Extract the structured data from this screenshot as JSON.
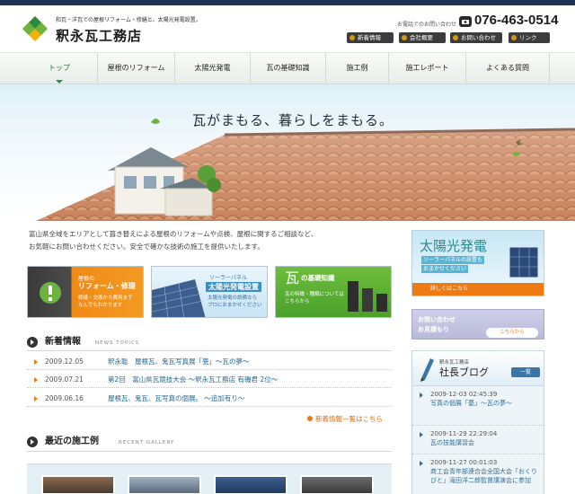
{
  "header": {
    "tagline": "和瓦・洋瓦での屋根リフォーム・修繕と、太陽光発電設置。",
    "company_name": "釈永瓦工務店",
    "phone_label": "お電話でのお問い合わせ",
    "phone_number": "076-463-0514",
    "utility_links": [
      "新着情報",
      "会社概要",
      "お問い合わせ",
      "リンク"
    ]
  },
  "nav": {
    "items": [
      "トップ",
      "屋根のリフォーム",
      "太陽光発電",
      "瓦の基礎知識",
      "施工例",
      "施工レポート",
      "よくある質問"
    ],
    "active_index": 0
  },
  "hero": {
    "tagline": "瓦がまもる、暮らしをまもる。"
  },
  "intro": {
    "lines": [
      "富山県全域をエリアとして葺き替えによる屋根のリフォームや点検、屋根に関するご相談など、",
      "お気軽にお問い合わせください。安全で確かな技術の施工を提供いたします。"
    ]
  },
  "services": [
    {
      "title_small": "屋根の",
      "title": "リフォーム・修理",
      "lines": [
        "修繕・交換から費用まで",
        "なんでもわかります"
      ]
    },
    {
      "title_small": "ソーラーパネル",
      "title": "太陽光発電設置",
      "lines": [
        "太陽光発電の設備なら",
        "プロにおまかせください"
      ]
    },
    {
      "title_small": "瓦",
      "title": "の基礎知識",
      "lines": [
        "瓦の特徴・種類については",
        "こちらから"
      ]
    }
  ],
  "news": {
    "heading": "新着情報",
    "subheading": "NEWS TOPICS",
    "items": [
      {
        "date": "2009.12.05",
        "title": "釈永聡　屋根瓦、鬼瓦写真展「甍」～瓦の夢～"
      },
      {
        "date": "2009.07.21",
        "title": "第2回　富山県瓦競技大会 ～釈永瓦工務店 有磯君 2位～"
      },
      {
        "date": "2009.06.16",
        "title": "屋根瓦、鬼瓦、瓦写真の個展。 ～追加有り～"
      }
    ],
    "more_label": "新着情報一覧はこちら"
  },
  "gallery": {
    "heading": "最近の施工例",
    "subheading": "RECENT GALLERY"
  },
  "sidebar": {
    "solar": {
      "title": "太陽光発電",
      "subtitle": "ソーラーパネルの設置も",
      "subtitle2": "おまかせください",
      "button": "詳しくはこちら"
    },
    "contact": {
      "line1": "お問い合わせ",
      "line2": "お見積もり",
      "button": "こちらから"
    },
    "blog": {
      "sub": "釈永瓦工務店",
      "title": "社長ブログ",
      "button": "一覧",
      "entries": [
        {
          "date": "2009-12-03 02:45:39",
          "title": "写真の個展「甍」～瓦の夢～"
        },
        {
          "date": "2009-11-29 22:29:04",
          "title": "瓦の技能講習会"
        },
        {
          "date": "2009-11-27 00:01:03",
          "title": "商工会青年部連合会全国大会「おくりびと」滝田洋二郎監督講演会に参加"
        }
      ]
    }
  },
  "colors": {
    "accent": "#ee7a12",
    "link": "#1d6a9a",
    "nav_active": "#1a7a2e",
    "dark": "#1c3354"
  },
  "icons": [
    "logo-mark",
    "phone-icon",
    "leaf-icon",
    "bird-icon"
  ]
}
